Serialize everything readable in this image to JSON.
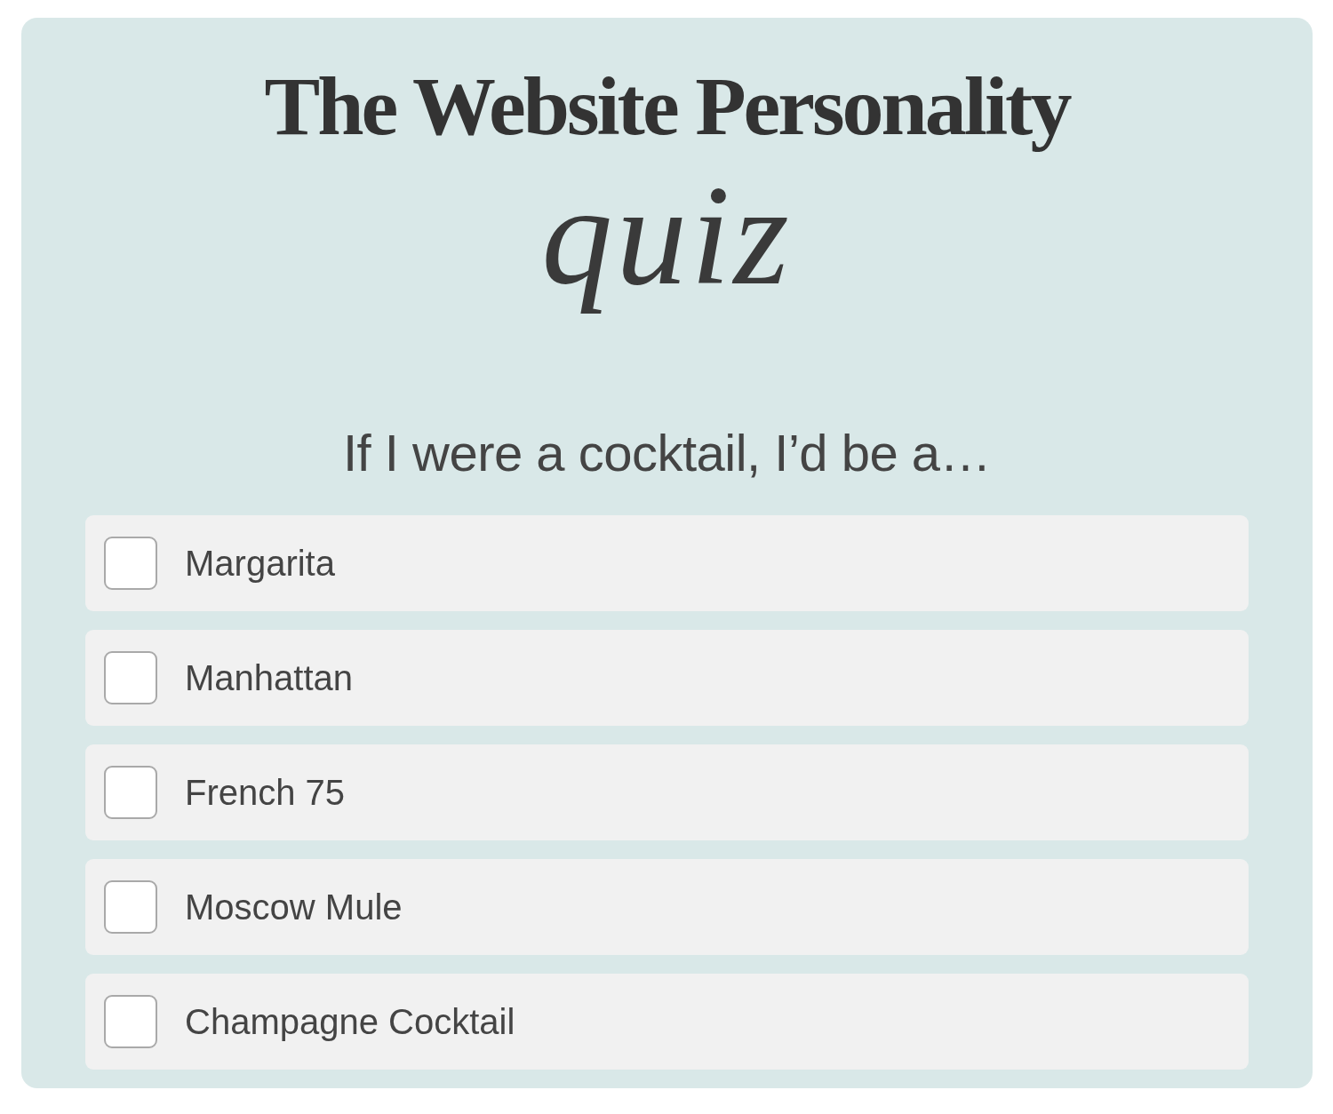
{
  "title": "The Website Personality",
  "subtitle": "quiz",
  "question": "If I were a cocktail, I’d be a…",
  "options": [
    {
      "label": "Margarita",
      "checked": false
    },
    {
      "label": "Manhattan",
      "checked": false
    },
    {
      "label": "French 75",
      "checked": false
    },
    {
      "label": "Moscow Mule",
      "checked": false
    },
    {
      "label": "Champagne Cocktail",
      "checked": false
    }
  ]
}
